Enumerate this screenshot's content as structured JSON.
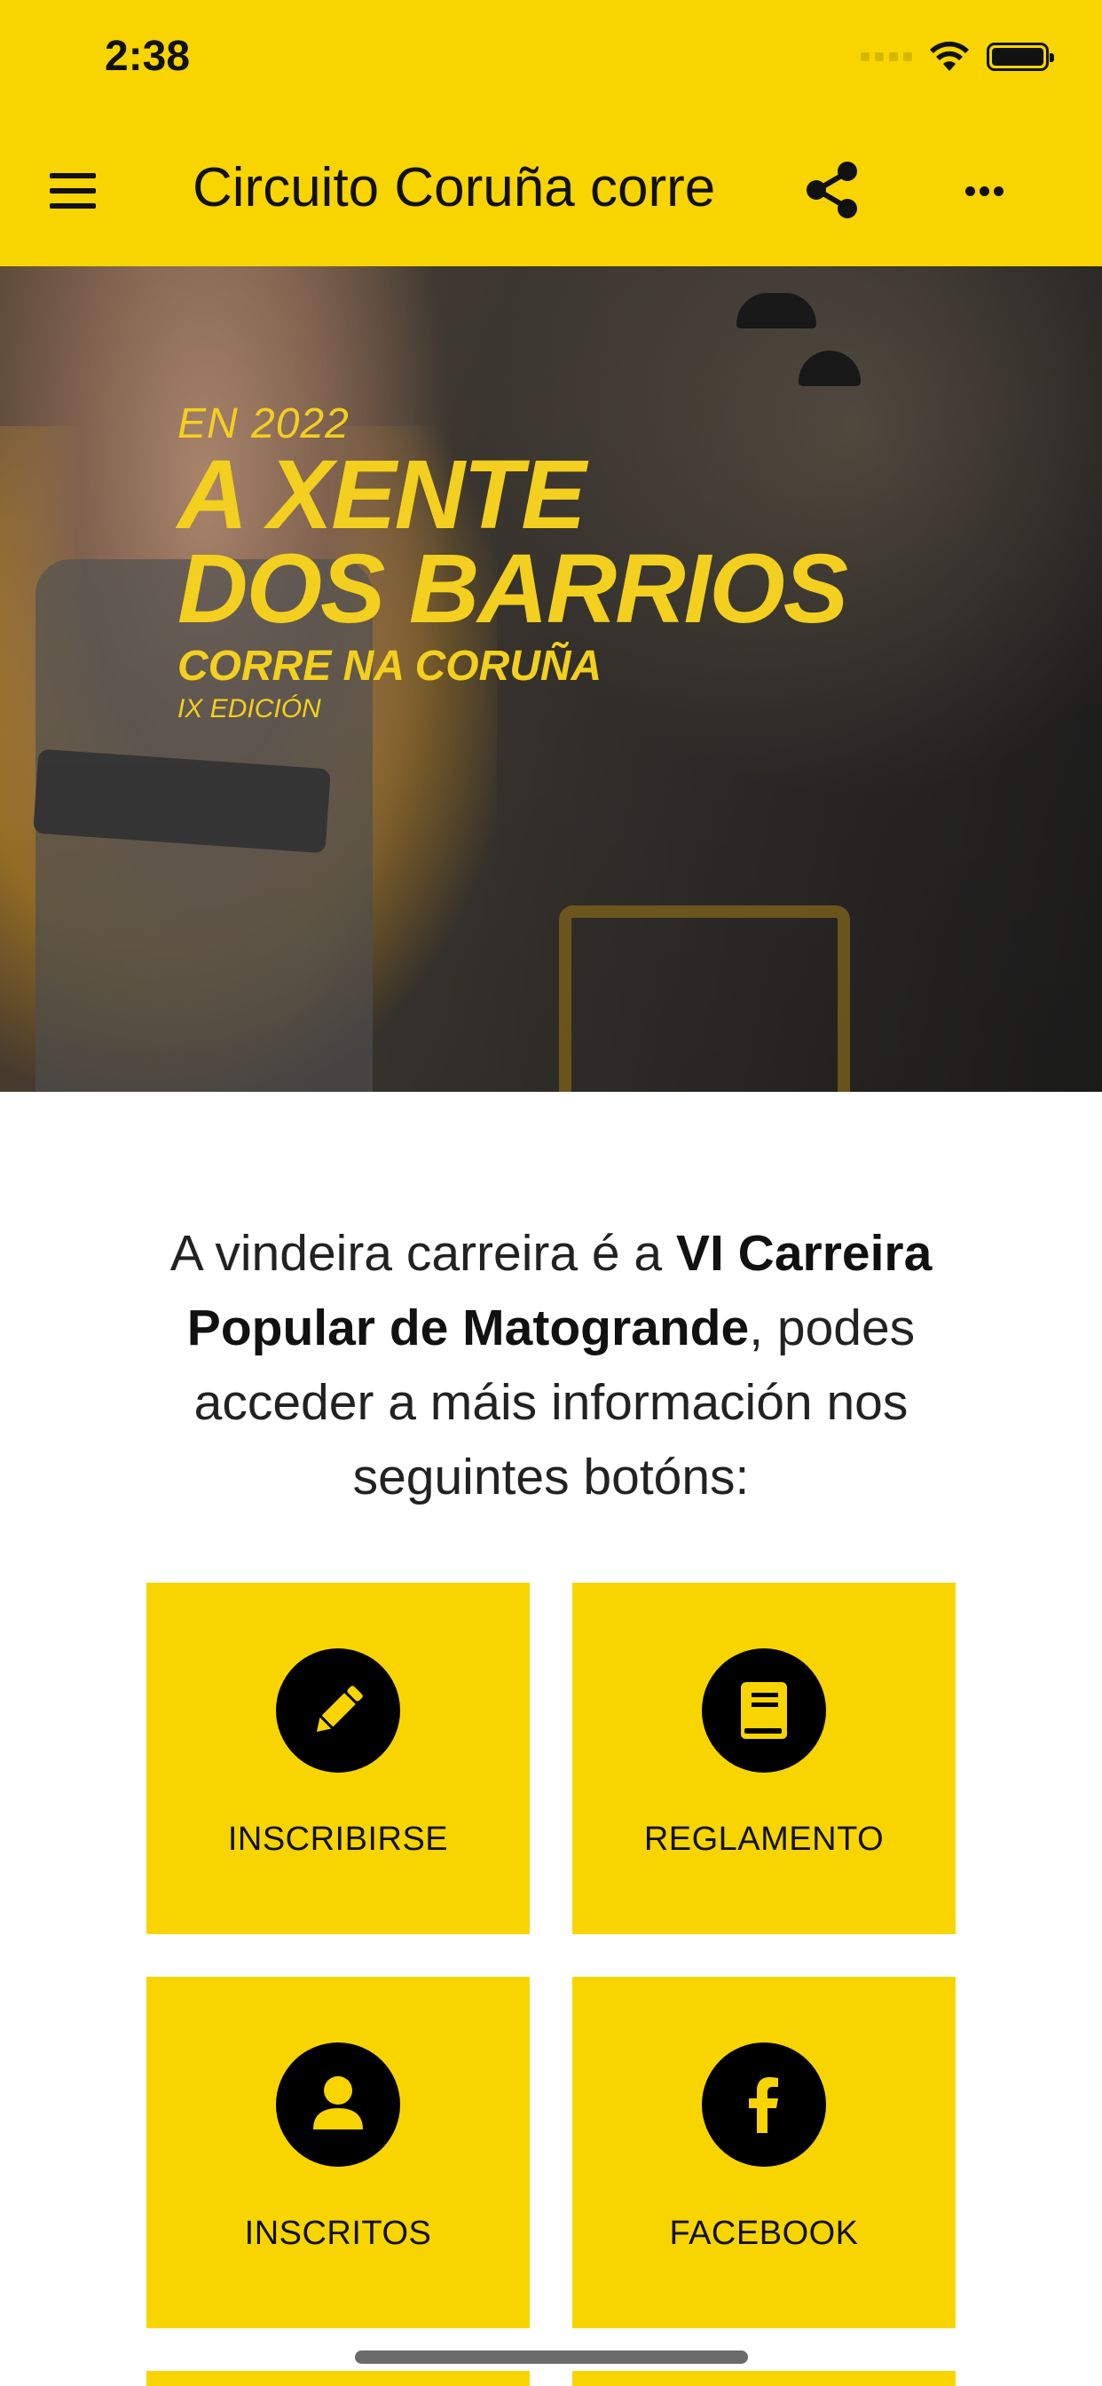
{
  "status_bar": {
    "time": "2:38"
  },
  "app_bar": {
    "title": "Circuito Coruña corre"
  },
  "banner": {
    "year_line": "EN 2022",
    "headline_1": "A XENTE",
    "headline_2": "DOS BARRIOS",
    "subline": "CORRE NA CORUÑA",
    "edition": "IX EDICIÓN"
  },
  "intro": {
    "prefix": "A vindeira carreira é a ",
    "highlight": "VI Carreira Popular de Matogrande",
    "suffix": ", podes acceder a máis información nos seguintes botóns:"
  },
  "tiles": [
    {
      "label": "INSCRIBIRSE",
      "icon": "pencil-icon"
    },
    {
      "label": "REGLAMENTO",
      "icon": "book-icon"
    },
    {
      "label": "INSCRITOS",
      "icon": "user-icon"
    },
    {
      "label": "FACEBOOK",
      "icon": "facebook-icon"
    }
  ],
  "colors": {
    "accent": "#f8d500",
    "icon_bg": "#000000"
  }
}
